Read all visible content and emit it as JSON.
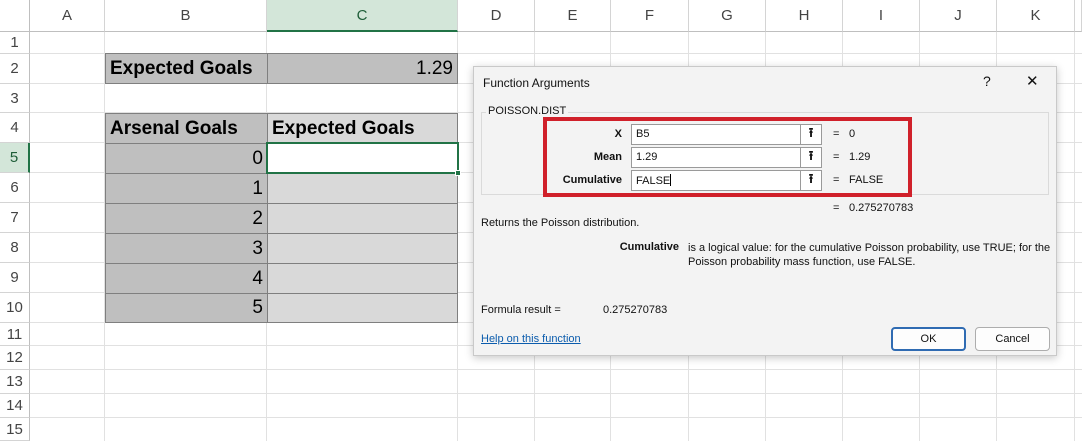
{
  "columns": [
    "A",
    "B",
    "C",
    "D",
    "E",
    "F",
    "G",
    "H",
    "I",
    "J",
    "K"
  ],
  "rows": [
    "1",
    "2",
    "3",
    "4",
    "5",
    "6",
    "7",
    "8",
    "9",
    "10",
    "11",
    "12",
    "13",
    "14",
    "15"
  ],
  "sheet": {
    "b2": "Expected Goals",
    "c2": "1.29",
    "b4": "Arsenal Goals",
    "c4": "Expected Goals",
    "goals": [
      "0",
      "1",
      "2",
      "3",
      "4",
      "5"
    ]
  },
  "dialog": {
    "title": "Function Arguments",
    "help_glyph": "?",
    "close_glyph": "✕",
    "function_name": "POISSON.DIST",
    "args": [
      {
        "label": "X",
        "value": "B5",
        "result": "0"
      },
      {
        "label": "Mean",
        "value": "1.29",
        "result": "1.29"
      },
      {
        "label": "Cumulative",
        "value": "FALSE",
        "result": "FALSE"
      }
    ],
    "equals": "=",
    "overall_result": "0.275270783",
    "description": "Returns the Poisson distribution.",
    "arg_help_name": "Cumulative",
    "arg_help_text": "is a logical value: for the cumulative Poisson probability, use TRUE; for the Poisson probability mass function, use FALSE.",
    "formula_result_label": "Formula result =",
    "formula_result_value": "0.275270783",
    "help_link": "Help on this function",
    "ok_label": "OK",
    "cancel_label": "Cancel"
  },
  "colors": {
    "highlight_box": "#d0202a",
    "selection": "#217346"
  }
}
